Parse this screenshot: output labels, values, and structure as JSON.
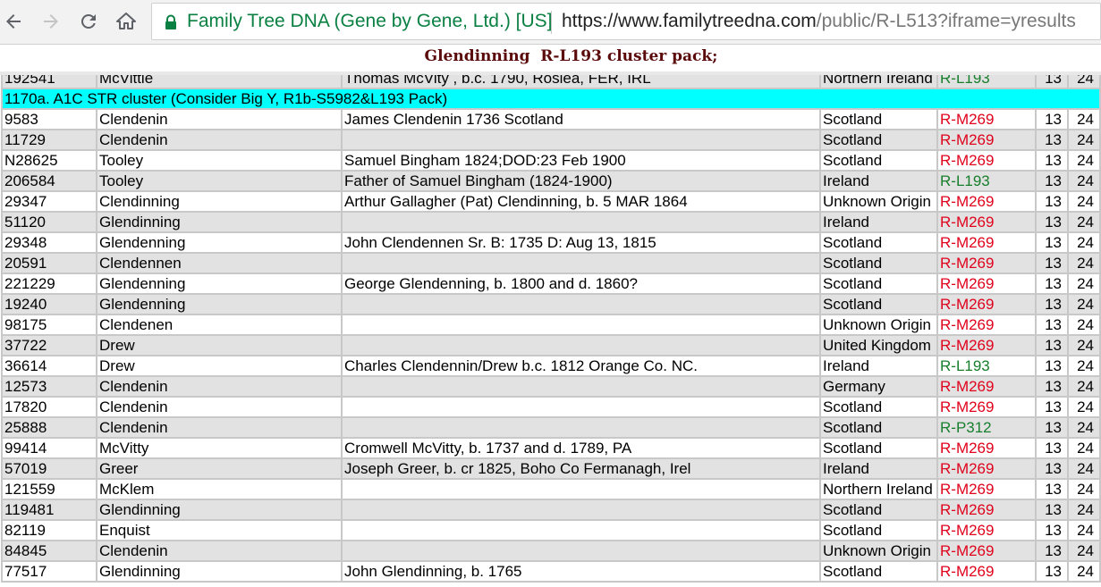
{
  "browser": {
    "site_name": "Family Tree DNA (Gene by Gene, Ltd.) [US]",
    "url_host": "https://www.familytreedna.com",
    "url_path": "/public/R-L513?iframe=yresults"
  },
  "page": {
    "title": "Glendinning  R-L193 cluster pack;"
  },
  "table": {
    "top_partial_row": [
      "192541",
      "McVittie",
      "Thomas McVity , b.c. 1790, Roslea, FER, IRL",
      "Northern Ireland",
      "R-L193",
      "13",
      "24"
    ],
    "cluster_label": "1170a. A1C STR cluster (Consider Big Y, R1b-S5982&L193 Pack)",
    "rows": [
      {
        "kit": "9583",
        "surname": "Clendenin",
        "ancestor": "James Clendenin 1736 Scotland",
        "country": "Scotland",
        "haplogroup": "R-M269",
        "hg_color": "red",
        "markers": "13",
        "total": "24"
      },
      {
        "kit": "11729",
        "surname": "Clendenin",
        "ancestor": "",
        "country": "Scotland",
        "haplogroup": "R-M269",
        "hg_color": "red",
        "markers": "13",
        "total": "24"
      },
      {
        "kit": "N28625",
        "surname": "Tooley",
        "ancestor": "Samuel Bingham 1824;DOD:23 Feb 1900",
        "country": "Scotland",
        "haplogroup": "R-M269",
        "hg_color": "red",
        "markers": "13",
        "total": "24"
      },
      {
        "kit": "206584",
        "surname": "Tooley",
        "ancestor": "Father of Samuel Bingham (1824-1900)",
        "country": "Ireland",
        "haplogroup": "R-L193",
        "hg_color": "green",
        "markers": "13",
        "total": "24"
      },
      {
        "kit": "29347",
        "surname": "Clendinning",
        "ancestor": "Arthur Gallagher (Pat) Clendinning, b. 5 MAR 1864",
        "country": "Unknown Origin",
        "haplogroup": "R-M269",
        "hg_color": "red",
        "markers": "13",
        "total": "24"
      },
      {
        "kit": "51120",
        "surname": "Glendinning",
        "ancestor": "",
        "country": "Ireland",
        "haplogroup": "R-M269",
        "hg_color": "red",
        "markers": "13",
        "total": "24"
      },
      {
        "kit": "29348",
        "surname": "Glendenning",
        "ancestor": "John Clendennen Sr. B: 1735 D: Aug 13, 1815",
        "country": "Scotland",
        "haplogroup": "R-M269",
        "hg_color": "red",
        "markers": "13",
        "total": "24"
      },
      {
        "kit": "20591",
        "surname": "Clendennen",
        "ancestor": "",
        "country": "Scotland",
        "haplogroup": "R-M269",
        "hg_color": "red",
        "markers": "13",
        "total": "24"
      },
      {
        "kit": "221229",
        "surname": "Glendenning",
        "ancestor": "George Glendenning, b. 1800 and d. 1860?",
        "country": "Scotland",
        "haplogroup": "R-M269",
        "hg_color": "red",
        "markers": "13",
        "total": "24"
      },
      {
        "kit": "19240",
        "surname": "Glendenning",
        "ancestor": "",
        "country": "Scotland",
        "haplogroup": "R-M269",
        "hg_color": "red",
        "markers": "13",
        "total": "24"
      },
      {
        "kit": "98175",
        "surname": "Clendenen",
        "ancestor": "",
        "country": "Unknown Origin",
        "haplogroup": "R-M269",
        "hg_color": "red",
        "markers": "13",
        "total": "24"
      },
      {
        "kit": "37722",
        "surname": "Drew",
        "ancestor": "",
        "country": "United Kingdom",
        "haplogroup": "R-M269",
        "hg_color": "red",
        "markers": "13",
        "total": "24"
      },
      {
        "kit": "36614",
        "surname": "Drew",
        "ancestor": "Charles Clendennin/Drew b.c. 1812 Orange Co. NC.",
        "country": "Ireland",
        "haplogroup": "R-L193",
        "hg_color": "green",
        "markers": "13",
        "total": "24"
      },
      {
        "kit": "12573",
        "surname": "Clendenin",
        "ancestor": "",
        "country": "Germany",
        "haplogroup": "R-M269",
        "hg_color": "red",
        "markers": "13",
        "total": "24"
      },
      {
        "kit": "17820",
        "surname": "Clendenin",
        "ancestor": "",
        "country": "Scotland",
        "haplogroup": "R-M269",
        "hg_color": "red",
        "markers": "13",
        "total": "24"
      },
      {
        "kit": "25888",
        "surname": "Clendenin",
        "ancestor": "",
        "country": "Scotland",
        "haplogroup": "R-P312",
        "hg_color": "green",
        "markers": "13",
        "total": "24"
      },
      {
        "kit": "99414",
        "surname": "McVitty",
        "ancestor": "Cromwell McVitty, b. 1737 and d. 1789, PA",
        "country": "Scotland",
        "haplogroup": "R-M269",
        "hg_color": "red",
        "markers": "13",
        "total": "24"
      },
      {
        "kit": "57019",
        "surname": "Greer",
        "ancestor": "Joseph Greer, b. cr 1825, Boho Co Fermanagh, Irel",
        "country": "Ireland",
        "haplogroup": "R-M269",
        "hg_color": "red",
        "markers": "13",
        "total": "24"
      },
      {
        "kit": "121559",
        "surname": "McKlem",
        "ancestor": "",
        "country": "Northern Ireland",
        "haplogroup": "R-M269",
        "hg_color": "red",
        "markers": "13",
        "total": "24"
      },
      {
        "kit": "119481",
        "surname": "Glendinning",
        "ancestor": "",
        "country": "Scotland",
        "haplogroup": "R-M269",
        "hg_color": "red",
        "markers": "13",
        "total": "24"
      },
      {
        "kit": "82119",
        "surname": "Enquist",
        "ancestor": "",
        "country": "Scotland",
        "haplogroup": "R-M269",
        "hg_color": "red",
        "markers": "13",
        "total": "24"
      },
      {
        "kit": "84845",
        "surname": "Clendenin",
        "ancestor": "",
        "country": "Unknown Origin",
        "haplogroup": "R-M269",
        "hg_color": "red",
        "markers": "13",
        "total": "24"
      },
      {
        "kit": "77517",
        "surname": "Glendinning",
        "ancestor": "John Glendinning, b. 1765",
        "country": "Scotland",
        "haplogroup": "R-M269",
        "hg_color": "red",
        "markers": "13",
        "total": "24"
      }
    ]
  }
}
